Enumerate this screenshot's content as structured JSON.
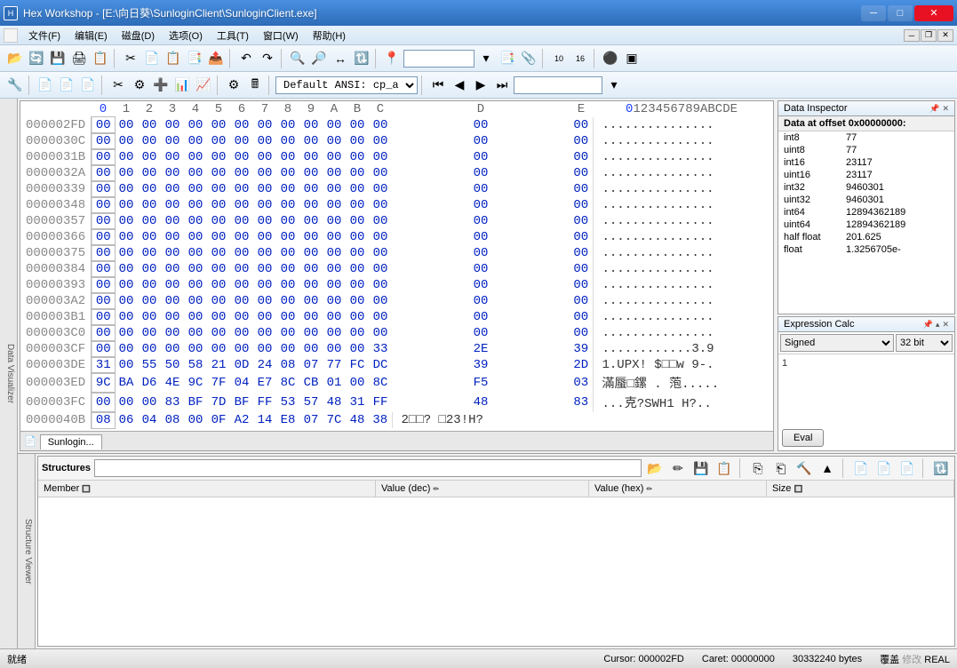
{
  "title": "Hex Workshop - [E:\\向日葵\\SunloginClient\\SunloginClient.exe]",
  "menu": [
    "文件(F)",
    "编辑(E)",
    "磁盘(D)",
    "选项(O)",
    "工具(T)",
    "窗口(W)",
    "帮助(H)"
  ],
  "encoding": "Default ANSI: cp_acp",
  "hex": {
    "cols": [
      "0",
      "1",
      "2",
      "3",
      "4",
      "5",
      "6",
      "7",
      "8",
      "9",
      "A",
      "B",
      "C",
      "D",
      "E"
    ],
    "asciihdr": "0123456789ABCDE",
    "rows": [
      {
        "o": "000002FD",
        "b": [
          "00",
          "00",
          "00",
          "00",
          "00",
          "00",
          "00",
          "00",
          "00",
          "00",
          "00",
          "00",
          "00",
          "00",
          "00"
        ],
        "a": "..............."
      },
      {
        "o": "0000030C",
        "b": [
          "00",
          "00",
          "00",
          "00",
          "00",
          "00",
          "00",
          "00",
          "00",
          "00",
          "00",
          "00",
          "00",
          "00",
          "00"
        ],
        "a": "..............."
      },
      {
        "o": "0000031B",
        "b": [
          "00",
          "00",
          "00",
          "00",
          "00",
          "00",
          "00",
          "00",
          "00",
          "00",
          "00",
          "00",
          "00",
          "00",
          "00"
        ],
        "a": "..............."
      },
      {
        "o": "0000032A",
        "b": [
          "00",
          "00",
          "00",
          "00",
          "00",
          "00",
          "00",
          "00",
          "00",
          "00",
          "00",
          "00",
          "00",
          "00",
          "00"
        ],
        "a": "..............."
      },
      {
        "o": "00000339",
        "b": [
          "00",
          "00",
          "00",
          "00",
          "00",
          "00",
          "00",
          "00",
          "00",
          "00",
          "00",
          "00",
          "00",
          "00",
          "00"
        ],
        "a": "..............."
      },
      {
        "o": "00000348",
        "b": [
          "00",
          "00",
          "00",
          "00",
          "00",
          "00",
          "00",
          "00",
          "00",
          "00",
          "00",
          "00",
          "00",
          "00",
          "00"
        ],
        "a": "..............."
      },
      {
        "o": "00000357",
        "b": [
          "00",
          "00",
          "00",
          "00",
          "00",
          "00",
          "00",
          "00",
          "00",
          "00",
          "00",
          "00",
          "00",
          "00",
          "00"
        ],
        "a": "..............."
      },
      {
        "o": "00000366",
        "b": [
          "00",
          "00",
          "00",
          "00",
          "00",
          "00",
          "00",
          "00",
          "00",
          "00",
          "00",
          "00",
          "00",
          "00",
          "00"
        ],
        "a": "..............."
      },
      {
        "o": "00000375",
        "b": [
          "00",
          "00",
          "00",
          "00",
          "00",
          "00",
          "00",
          "00",
          "00",
          "00",
          "00",
          "00",
          "00",
          "00",
          "00"
        ],
        "a": "..............."
      },
      {
        "o": "00000384",
        "b": [
          "00",
          "00",
          "00",
          "00",
          "00",
          "00",
          "00",
          "00",
          "00",
          "00",
          "00",
          "00",
          "00",
          "00",
          "00"
        ],
        "a": "..............."
      },
      {
        "o": "00000393",
        "b": [
          "00",
          "00",
          "00",
          "00",
          "00",
          "00",
          "00",
          "00",
          "00",
          "00",
          "00",
          "00",
          "00",
          "00",
          "00"
        ],
        "a": "..............."
      },
      {
        "o": "000003A2",
        "b": [
          "00",
          "00",
          "00",
          "00",
          "00",
          "00",
          "00",
          "00",
          "00",
          "00",
          "00",
          "00",
          "00",
          "00",
          "00"
        ],
        "a": "..............."
      },
      {
        "o": "000003B1",
        "b": [
          "00",
          "00",
          "00",
          "00",
          "00",
          "00",
          "00",
          "00",
          "00",
          "00",
          "00",
          "00",
          "00",
          "00",
          "00"
        ],
        "a": "..............."
      },
      {
        "o": "000003C0",
        "b": [
          "00",
          "00",
          "00",
          "00",
          "00",
          "00",
          "00",
          "00",
          "00",
          "00",
          "00",
          "00",
          "00",
          "00",
          "00"
        ],
        "a": "..............."
      },
      {
        "o": "000003CF",
        "b": [
          "00",
          "00",
          "00",
          "00",
          "00",
          "00",
          "00",
          "00",
          "00",
          "00",
          "00",
          "00",
          "33",
          "2E",
          "39"
        ],
        "a": "............3.9"
      },
      {
        "o": "000003DE",
        "b": [
          "31",
          "00",
          "55",
          "50",
          "58",
          "21",
          "0D",
          "24",
          "08",
          "07",
          "77",
          "FC",
          "DC",
          "39",
          "2D"
        ],
        "a": "1.UPX! $□□w 9-."
      },
      {
        "o": "000003ED",
        "b": [
          "9C",
          "BA",
          "D6",
          "4E",
          "9C",
          "7F",
          "04",
          "E7",
          "8C",
          "CB",
          "01",
          "00",
          "8C",
          "F5",
          "03"
        ],
        "a": "滿蜃□鏍 . 萢....."
      },
      {
        "o": "000003FC",
        "b": [
          "00",
          "00",
          "00",
          "83",
          "BF",
          "7D",
          "BF",
          "FF",
          "53",
          "57",
          "48",
          "31",
          "FF",
          "48",
          "83"
        ],
        "a": "...克?SWH1 H?.."
      },
      {
        "o": "0000040B",
        "b": [
          "08",
          "06",
          "04",
          "08",
          "00",
          "0F",
          "A2",
          "14",
          "E8",
          "07",
          "7C",
          "48",
          "38"
        ],
        "a": "2□□? □23!H?"
      }
    ]
  },
  "tab": "Sunlogin...",
  "inspector": {
    "title": "Data Inspector",
    "header": "Data at offset 0x00000000:",
    "rows": [
      [
        "int8",
        "77"
      ],
      [
        "uint8",
        "77"
      ],
      [
        "int16",
        "23117"
      ],
      [
        "uint16",
        "23117"
      ],
      [
        "int32",
        "9460301"
      ],
      [
        "uint32",
        "9460301"
      ],
      [
        "int64",
        "12894362189"
      ],
      [
        "uint64",
        "12894362189"
      ],
      [
        "half float",
        "201.625"
      ],
      [
        "float",
        "1.3256705e-"
      ]
    ]
  },
  "expr": {
    "title": "Expression Calc",
    "signed": "Signed",
    "bits": "32 bit",
    "value": "1",
    "eval": "Eval"
  },
  "struct": {
    "label": "Structures",
    "cols": [
      "Member",
      "Value (dec)",
      "Value (hex)",
      "Size"
    ]
  },
  "status": {
    "ready": "就绪",
    "cursor": "Cursor: 000002FD",
    "caret": "Caret: 00000000",
    "size": "30332240 bytes",
    "over": "覆盖",
    "mod": "修改",
    "real": "REAL"
  },
  "vtab_left": "Data Visualizer",
  "vtab_bottom": "Structure Viewer"
}
